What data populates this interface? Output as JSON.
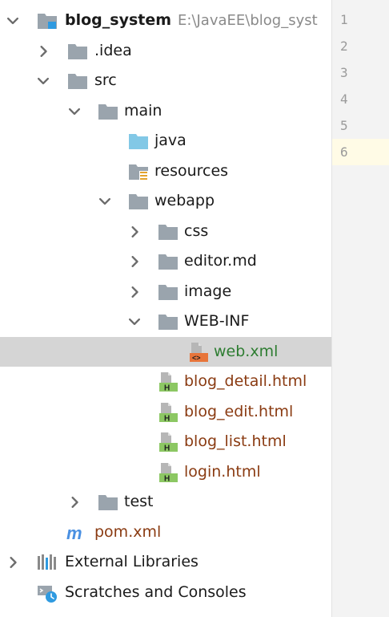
{
  "project": {
    "name": "blog_system",
    "path": "E:\\JavaEE\\blog_syst"
  },
  "tree": {
    "idea": ".idea",
    "src": "src",
    "main": "main",
    "java": "java",
    "resources": "resources",
    "webapp": "webapp",
    "css": "css",
    "editor_md": "editor.md",
    "image": "image",
    "web_inf": "WEB-INF",
    "web_xml": "web.xml",
    "blog_detail": "blog_detail.html",
    "blog_edit": "blog_edit.html",
    "blog_list": "blog_list.html",
    "login": "login.html",
    "test": "test",
    "pom": "pom.xml",
    "external_libraries": "External Libraries",
    "scratches": "Scratches and Consoles"
  },
  "gutter": {
    "line_numbers": [
      "1",
      "2",
      "3",
      "4",
      "5",
      "6"
    ],
    "current_line": "6"
  },
  "colors": {
    "folder": "#9aa4ad",
    "source_folder": "#82c8e6",
    "html_badge": "#8cc763",
    "xml_badge": "#e8753a",
    "selection": "#d5d5d5",
    "maven": "#4a90e2"
  }
}
